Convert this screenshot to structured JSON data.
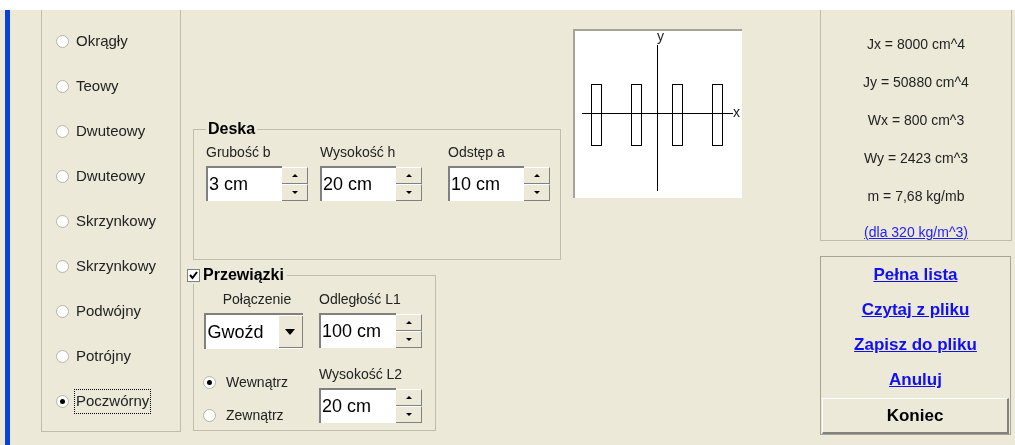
{
  "shape_options": [
    {
      "label": "Okrągły",
      "selected": false
    },
    {
      "label": "Teowy",
      "selected": false
    },
    {
      "label": "Dwuteowy",
      "selected": false
    },
    {
      "label": "Dwuteowy",
      "selected": false
    },
    {
      "label": "Skrzynkowy",
      "selected": false
    },
    {
      "label": "Skrzynkowy",
      "selected": false
    },
    {
      "label": "Podwójny",
      "selected": false
    },
    {
      "label": "Potrójny",
      "selected": false
    },
    {
      "label": "Poczwórny",
      "selected": true
    }
  ],
  "deska": {
    "title": "Deska",
    "fields": [
      {
        "label": "Grubość b",
        "value": "3 cm"
      },
      {
        "label": "Wysokość h",
        "value": "20 cm"
      },
      {
        "label": "Odstęp a",
        "value": "10 cm"
      }
    ]
  },
  "przewiazki": {
    "title": "Przewiązki",
    "checked": true,
    "connection": {
      "label": "Połączenie",
      "value": "Gwoźd"
    },
    "distance": {
      "label": "Odległość L1",
      "value": "100 cm"
    },
    "placement": [
      {
        "label": "Wewnątrz",
        "selected": true
      },
      {
        "label": "Zewnątrz",
        "selected": false
      }
    ],
    "height": {
      "label": "Wysokość L2",
      "value": "20 cm"
    }
  },
  "cross_section": {
    "y_axis_label": "y",
    "x_axis_label": "x"
  },
  "properties": [
    {
      "name": "Jx =",
      "value": "8000 cm^4"
    },
    {
      "name": "Jy =",
      "value": "50880 cm^4"
    },
    {
      "name": "Wx =",
      "value": "800 cm^3"
    },
    {
      "name": "Wy =",
      "value": "2423 cm^3"
    },
    {
      "name": "m =",
      "value": "7,68 kg/mb"
    }
  ],
  "density_link": "(dla 320 kg/m^3)",
  "actions": [
    {
      "label": "Pełna lista",
      "kind": "link"
    },
    {
      "label": "Czytaj z pliku",
      "kind": "link"
    },
    {
      "label": "Zapisz do pliku",
      "kind": "link"
    },
    {
      "label": "Anuluj",
      "kind": "link"
    },
    {
      "label": "Koniec",
      "kind": "button"
    }
  ]
}
